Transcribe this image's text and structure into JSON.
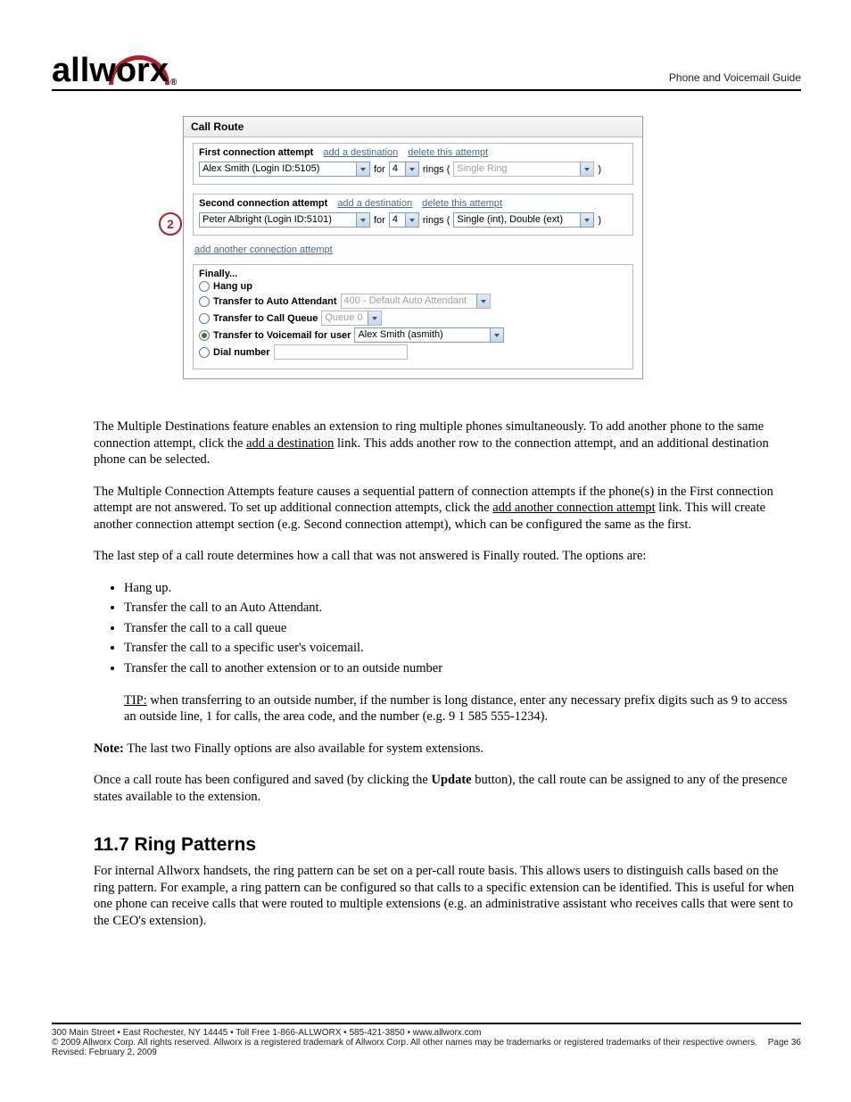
{
  "header": {
    "right": "Phone and Voicemail Guide"
  },
  "logo": {
    "brand": "allworx",
    "reg": "®"
  },
  "callout": "2",
  "screenshot": {
    "title": "Call Route",
    "attempt1": {
      "heading": "First connection attempt",
      "add": "add a destination",
      "del": "delete this attempt",
      "user": "Alex Smith (Login ID:5105)",
      "for": "for",
      "ringsNum": "4",
      "ringsLabel": "rings (",
      "ringType": "Single Ring"
    },
    "attempt2": {
      "heading": "Second connection attempt",
      "add": "add a destination",
      "del": "delete this attempt",
      "user": "Peter Albright (Login ID:5101)",
      "for": "for",
      "ringsNum": "4",
      "ringsLabel": "rings (",
      "ringType": "Single (int), Double (ext)"
    },
    "addAnother": "add another connection attempt",
    "finally": {
      "title": "Finally...",
      "hang": "Hang up",
      "auto": "Transfer to Auto Attendant",
      "autoSel": "400 - Default Auto Attendant",
      "queue": "Transfer to Call Queue",
      "queueSel": "Queue 0",
      "vm": "Transfer to Voicemail for user",
      "vmSel": "Alex Smith (asmith)",
      "dial": "Dial number"
    }
  },
  "body": {
    "p1a": "The Multiple Destinations feature enables an extension to ring multiple phones simultaneously. To add another phone to the same connection attempt, click the ",
    "p1link": "add a destination",
    "p1b": " link. This adds another row to the connection attempt, and an additional destination phone can be selected.",
    "p2a": "The Multiple Connection Attempts feature causes a sequential pattern of connection attempts if the phone(s) in the First connection attempt are not answered. To set up additional connection attempts, click the ",
    "p2link": "add another connection attempt",
    "p2b": " link. This will create another connection attempt section (e.g. Second connection attempt), which can be configured the same as the first.",
    "p3": "The last step of a call route determines how a call that was not answered is Finally routed. The options are:",
    "li1": "Hang up.",
    "li2": "Transfer the call to an Auto Attendant.",
    "li3": "Transfer the call to a call queue",
    "li4": "Transfer the call to a specific user's voicemail.",
    "li5": "Transfer the call to another extension or to an outside number",
    "tipLabel": "TIP:",
    "tip": " when transferring to an outside number, if the number is long distance, enter any necessary prefix digits such as 9 to access an outside line, 1 for calls, the area code, and the number (e.g. 9 1 585 555-1234).",
    "noteB": "Note:",
    "note": " The last two Finally options are also available for system extensions.",
    "p4a": "Once a call route has been configured and saved (by clicking the ",
    "p4b": "Update",
    "p4c": " button), the call route can be assigned to any of the presence states available to the extension.",
    "sect": "11.7 Ring Patterns",
    "p5": "For internal Allworx handsets, the ring pattern can be set on a per-call route basis. This allows users to distinguish calls based on the ring pattern. For example, a ring pattern can be configured so that calls to a specific extension can be identified. This is useful for when one phone can receive calls that were routed to multiple extensions (e.g. an administrative assistant who receives calls that were sent to the CEO's extension)."
  },
  "footer": {
    "left1": "300 Main Street • East Rochester, NY 14445 • Toll Free 1-866-ALLWORX • 585-421-3850 • www.allworx.com",
    "left2": "© 2009 Allworx Corp. All rights reserved. Allworx is a registered trademark of Allworx Corp. All other names may be trademarks or registered trademarks of their respective owners.",
    "left3": "Revised: February 2, 2009",
    "rightTop": "",
    "page": "Page 36"
  }
}
